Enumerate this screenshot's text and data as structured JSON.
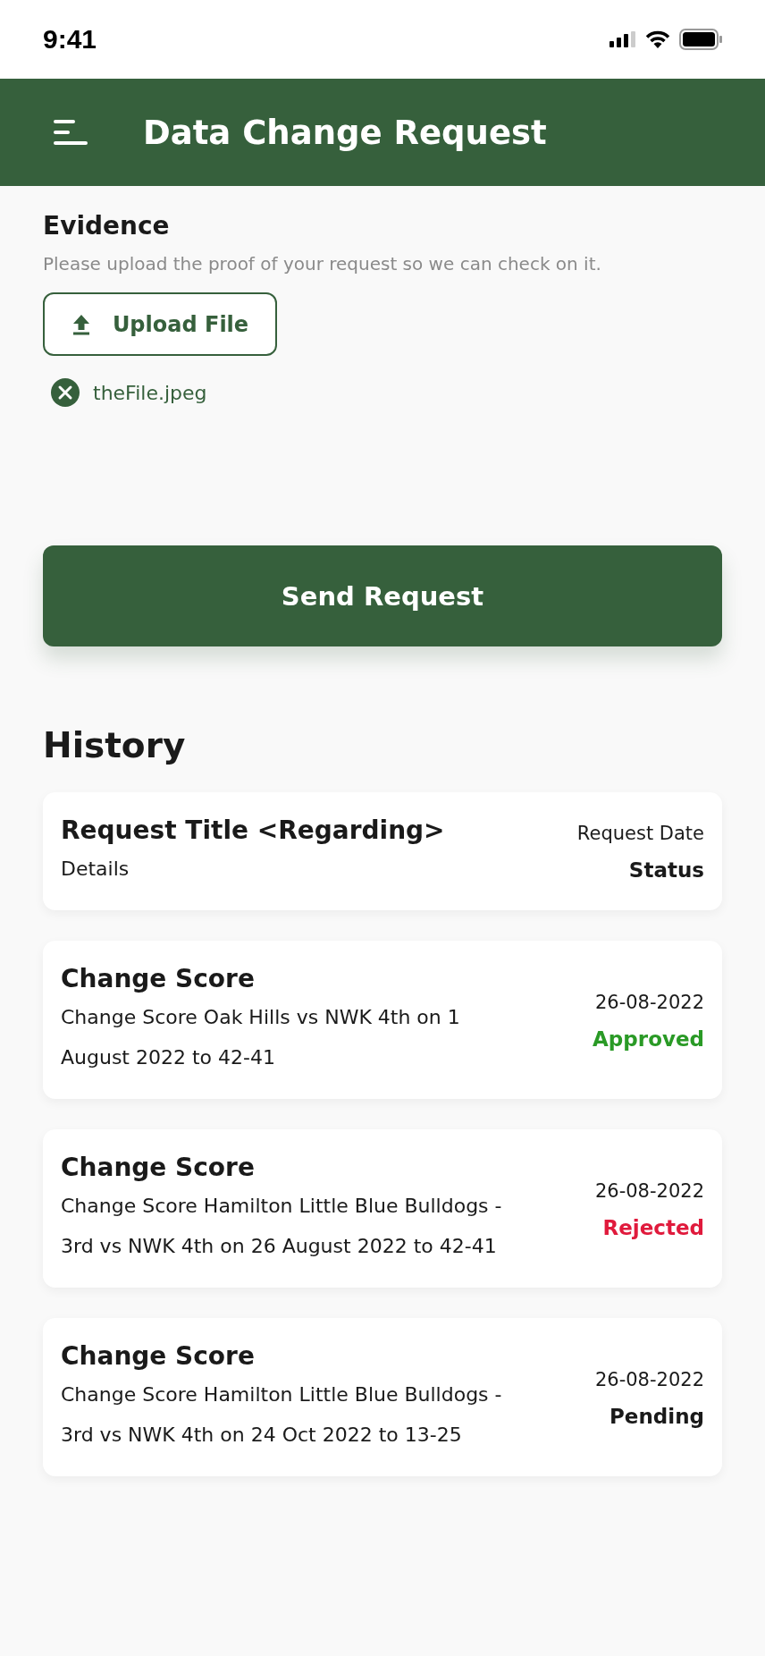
{
  "status_bar": {
    "time": "9:41"
  },
  "header": {
    "title": "Data Change Request"
  },
  "evidence": {
    "title": "Evidence",
    "hint": "Please upload the proof of your request so we can check on it.",
    "upload_button": "Upload File",
    "files": [
      {
        "name": "theFile.jpeg"
      }
    ]
  },
  "send_button": "Send Request",
  "history": {
    "title": "History",
    "items": [
      {
        "title": "Request Title <Regarding>",
        "details": "Details",
        "date": "Request Date",
        "status": "Status",
        "color": "#1a1a1a"
      },
      {
        "title": "Change Score",
        "details": "Change Score Oak Hills vs NWK 4th on 1 August 2022 to 42-41",
        "date": "26-08-2022",
        "status": "Approved",
        "color": "#2a9a26"
      },
      {
        "title": "Change Score",
        "details": "Change Score Hamilton Little Blue Bulldogs - 3rd vs NWK 4th on 26 August 2022 to 42-41",
        "date": "26-08-2022",
        "status": "Rejected",
        "color": "#e01a3c"
      },
      {
        "title": "Change Score",
        "details": "Change Score Hamilton Little Blue Bulldogs - 3rd vs NWK 4th on 24 Oct 2022 to 13-25",
        "date": "26-08-2022",
        "status": "Pending",
        "color": "#1a1a1a"
      }
    ]
  }
}
